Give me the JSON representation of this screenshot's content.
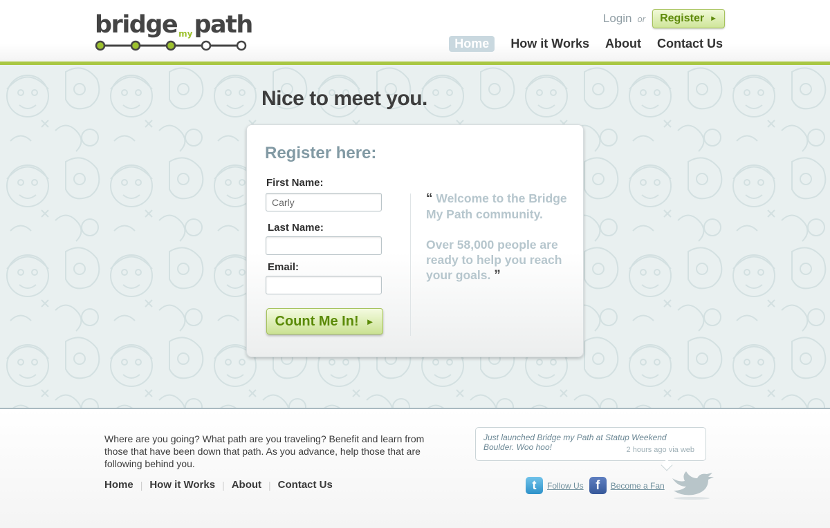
{
  "logo": {
    "part1": "bridge",
    "part2": "my",
    "part3": "path"
  },
  "auth": {
    "login": "Login",
    "or": "or",
    "register": "Register"
  },
  "nav": {
    "home": "Home",
    "how_it_works": "How it Works",
    "about": "About",
    "contact": "Contact Us"
  },
  "hero": {
    "title": "Nice to meet you."
  },
  "form": {
    "title": "Register here:",
    "first_name_label": "First Name:",
    "first_name_value": "Carly",
    "last_name_label": "Last Name:",
    "last_name_value": "",
    "email_label": "Email:",
    "email_value": "",
    "submit": "Count Me In!"
  },
  "quote": {
    "open": "“",
    "line1": "Welcome to the Bridge My Path community.",
    "line2": "Over 58,000 people are ready to help you reach your goals.",
    "close": "”"
  },
  "footer": {
    "text": "Where are you going?  What path are you traveling?  Benefit and learn from those that have been down that path.  As you advance, help those that are following behind you.",
    "nav": {
      "home": "Home",
      "how_it_works": "How it Works",
      "about": "About",
      "contact": "Contact Us"
    }
  },
  "tweet": {
    "text": "Just launched Bridge my Path at Statup Weekend Boulder. Woo hoo!",
    "meta": "2 hours ago via web"
  },
  "social": {
    "follow": "Follow Us",
    "fan": "Become a Fan"
  },
  "colors": {
    "accent_green": "#a9c743",
    "button_text": "#5a8a06",
    "hero_bg": "#e9f0f0",
    "quote_text": "#b6c6cd"
  }
}
